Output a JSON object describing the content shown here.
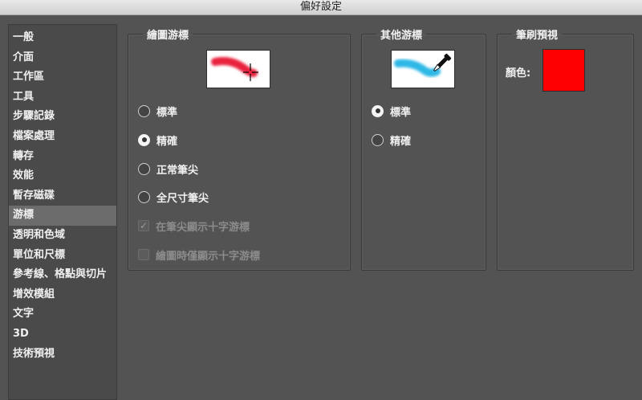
{
  "window": {
    "title": "偏好設定"
  },
  "sidebar": {
    "items": [
      {
        "label": "一般"
      },
      {
        "label": "介面"
      },
      {
        "label": "工作區"
      },
      {
        "label": "工具"
      },
      {
        "label": "步驟記錄"
      },
      {
        "label": "檔案處理"
      },
      {
        "label": "轉存"
      },
      {
        "label": "效能"
      },
      {
        "label": "暫存磁碟"
      },
      {
        "label": "游標"
      },
      {
        "label": "透明和色域"
      },
      {
        "label": "單位和尺標"
      },
      {
        "label": "參考線、格點與切片"
      },
      {
        "label": "增效模組"
      },
      {
        "label": "文字"
      },
      {
        "label": "3D"
      },
      {
        "label": "技術預視"
      }
    ],
    "selected": "游標"
  },
  "painting_cursors": {
    "title": "繪圖游標",
    "preview_icon": "brush-crosshair-icon",
    "options": [
      {
        "label": "標準",
        "checked": false
      },
      {
        "label": "精確",
        "checked": true
      },
      {
        "label": "正常筆尖",
        "checked": false
      },
      {
        "label": "全尺寸筆尖",
        "checked": false
      }
    ],
    "checkboxes": [
      {
        "label": "在筆尖顯示十字游標",
        "checked": true,
        "disabled": true
      },
      {
        "label": "繪圖時僅顯示十字游標",
        "checked": false,
        "disabled": true
      }
    ]
  },
  "other_cursors": {
    "title": "其他游標",
    "preview_icon": "eyedropper-icon",
    "options": [
      {
        "label": "標準",
        "checked": true
      },
      {
        "label": "精確",
        "checked": false
      }
    ]
  },
  "brush_preview": {
    "title": "筆刷預視",
    "color_label": "顏色:",
    "color": "#ff0000"
  }
}
